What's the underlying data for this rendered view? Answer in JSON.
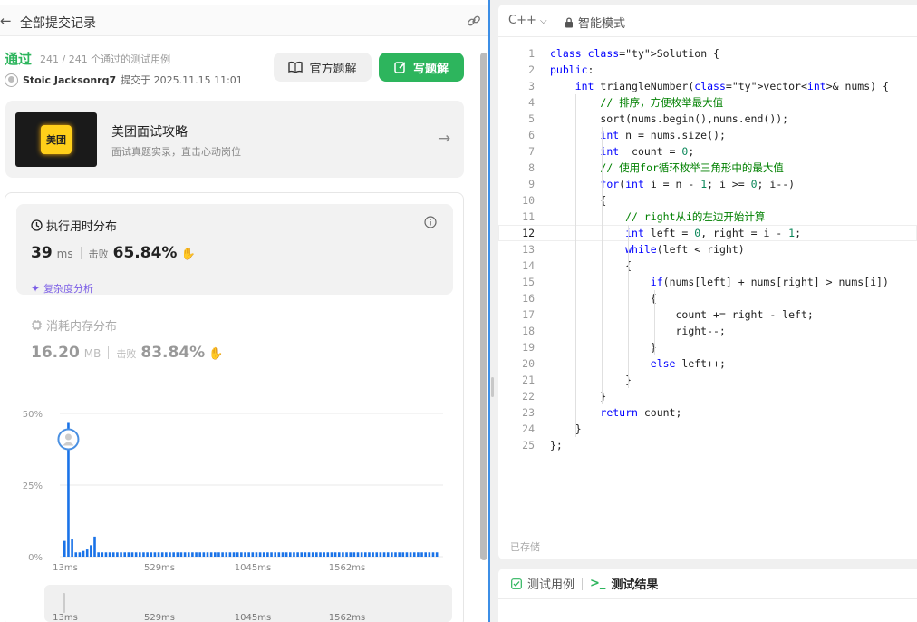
{
  "header": {
    "back_icon": "arrow-left-icon",
    "title": "全部提交记录",
    "link_icon": "link-icon"
  },
  "submission": {
    "status": "通过",
    "tests": "241 / 241 个通过的测试用例",
    "user": "Stoic Jacksonrq7",
    "submitted": "提交于 2025.11.15 11:01"
  },
  "actions": {
    "official": "官方题解",
    "write": "写题解"
  },
  "promo": {
    "logo": "美团",
    "title": "美团面试攻略",
    "subtitle": "面试真题实录，直击心动岗位"
  },
  "runtime": {
    "title": "执行用时分布",
    "value": "39",
    "unit": "ms",
    "beat_label": "击败",
    "beat_pct": "65.84%",
    "complexity": "复杂度分析"
  },
  "memory": {
    "title": "消耗内存分布",
    "value": "16.20",
    "unit": "MB",
    "beat_label": "击败",
    "beat_pct": "83.84%"
  },
  "chart_data": {
    "type": "bar",
    "y_ticks": [
      "50%",
      "25%",
      "0%"
    ],
    "x_ticks": [
      "13ms",
      "529ms",
      "1045ms",
      "1562ms"
    ],
    "ylim": [
      0,
      50
    ],
    "values": [
      5.5,
      47,
      6,
      1.5,
      1.5,
      2,
      2.5,
      4,
      7,
      1.5,
      1.5,
      1.5,
      1.5,
      1.5,
      1.5,
      1.5,
      1.5,
      1.5,
      1.5,
      1.5,
      1.5,
      1.5,
      1.5,
      1.5,
      1.5,
      1.5,
      1.5,
      1.5,
      1.5,
      1.5,
      1.5,
      1.5,
      1.5,
      1.5,
      1.5,
      1.5,
      1.5,
      1.5,
      1.5,
      1.5,
      1.5,
      1.5,
      1.5,
      1.5,
      1.5,
      1.5,
      1.5,
      1.5,
      1.5,
      1.5,
      1.5,
      1.5,
      1.5,
      1.5,
      1.5,
      1.5,
      1.5,
      1.5,
      1.5,
      1.5,
      1.5,
      1.5,
      1.5,
      1.5,
      1.5,
      1.5,
      1.5,
      1.5,
      1.5,
      1.5,
      1.5,
      1.5,
      1.5,
      1.5,
      1.5,
      1.5,
      1.5,
      1.5,
      1.5,
      1.5,
      1.5,
      1.5,
      1.5,
      1.5,
      1.5,
      1.5,
      1.5,
      1.5,
      1.5,
      1.5,
      1.5,
      1.5,
      1.5,
      1.5,
      1.5,
      1.5,
      1.5,
      1.5,
      1.5,
      1.5
    ],
    "highlight_index": 1,
    "color": "#1a73e8"
  },
  "editor": {
    "language": "C++",
    "mode": "智能模式",
    "saved": "已存储",
    "lines": [
      "class Solution {",
      "public:",
      "    int triangleNumber(vector<int>& nums) {",
      "        // 排序，方便枚举最大值",
      "        sort(nums.begin(),nums.end());",
      "        int n = nums.size();",
      "        int  count = 0;",
      "        // 使用for循环枚举三角形中的最大值",
      "        for(int i = n - 1; i >= 0; i--)",
      "        {",
      "            // right从i的左边开始计算",
      "            int left = 0, right = i - 1;",
      "            while(left < right)",
      "            {",
      "                if(nums[left] + nums[right] > nums[i])",
      "                {",
      "                    count += right - left;",
      "                    right--;",
      "                }",
      "                else left++;",
      "            }",
      "        }",
      "        return count;",
      "    }",
      "};"
    ],
    "active_line": 12
  },
  "tests": {
    "tab1": "测试用例",
    "tab2": "测试结果"
  }
}
